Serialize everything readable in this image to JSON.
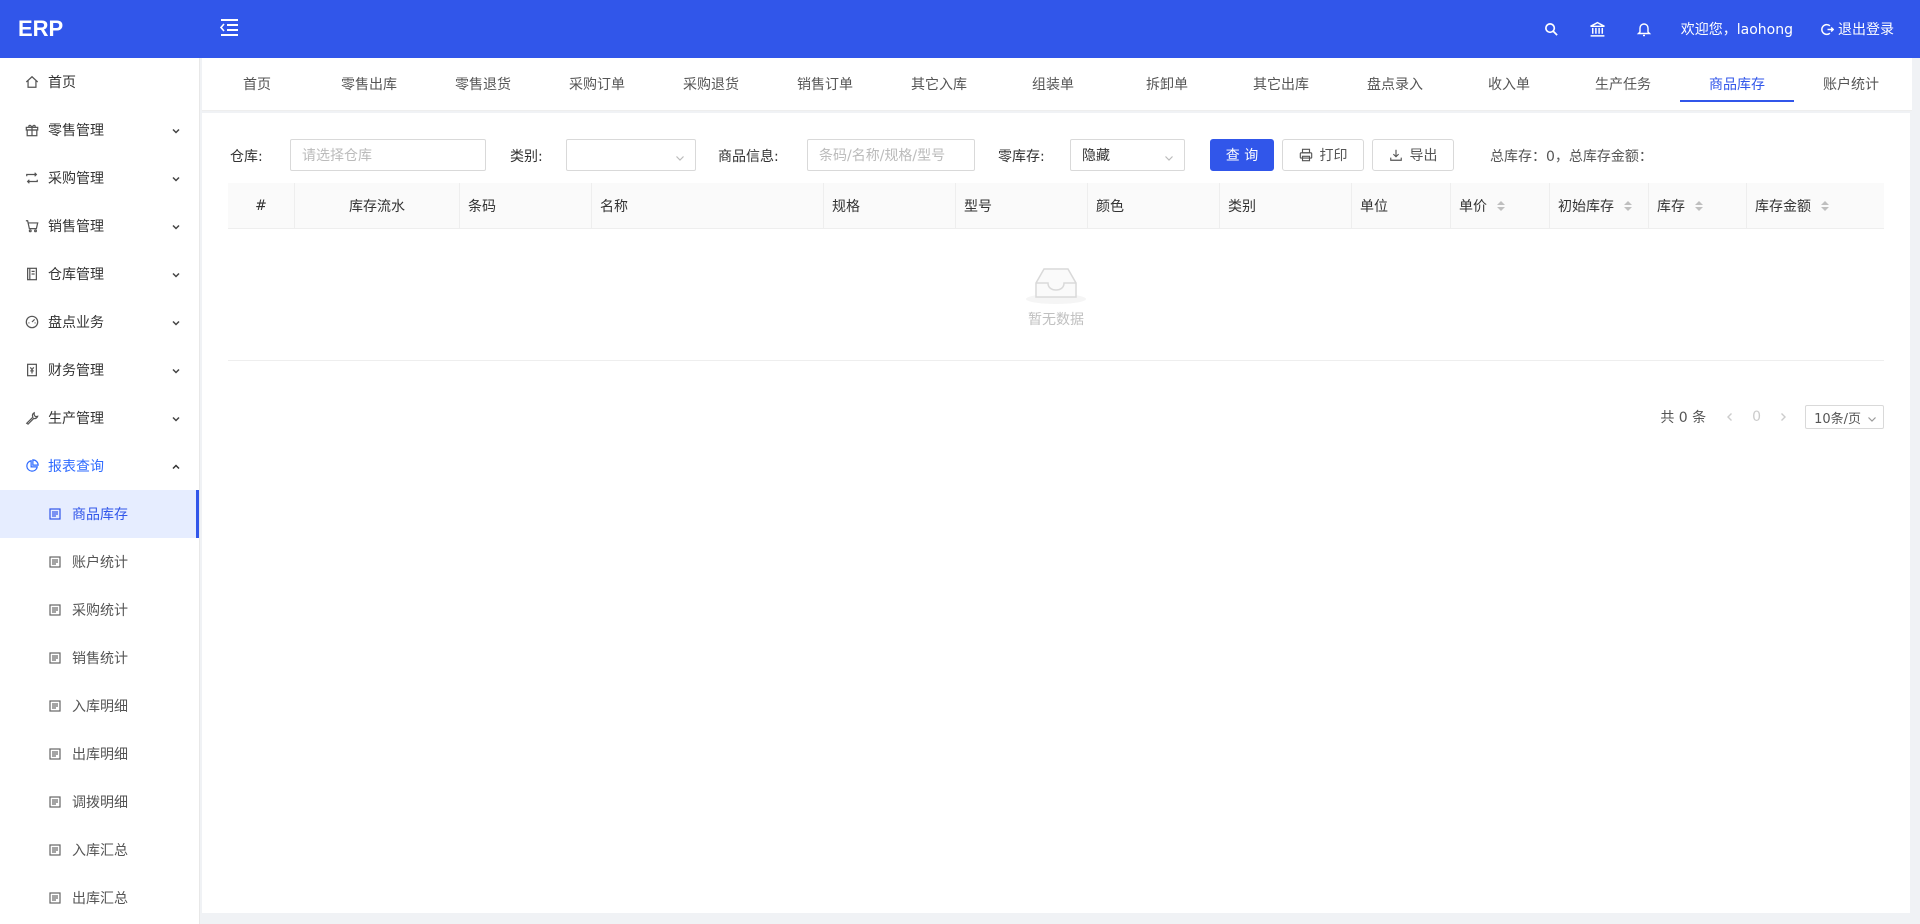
{
  "app": {
    "logo": "ERP"
  },
  "header": {
    "welcome": "欢迎您，laohong",
    "logout_label": "退出登录"
  },
  "sidebar": {
    "items": [
      {
        "label": "首页",
        "icon": "home-icon"
      },
      {
        "label": "零售管理",
        "icon": "gift-icon"
      },
      {
        "label": "采购管理",
        "icon": "swap-icon"
      },
      {
        "label": "销售管理",
        "icon": "cart-icon"
      },
      {
        "label": "仓库管理",
        "icon": "book-icon"
      },
      {
        "label": "盘点业务",
        "icon": "dashboard-icon"
      },
      {
        "label": "财务管理",
        "icon": "money-icon"
      },
      {
        "label": "生产管理",
        "icon": "tool-icon"
      },
      {
        "label": "报表查询",
        "icon": "pie-icon"
      }
    ],
    "sub_items": [
      {
        "label": "商品库存",
        "icon": "doc-icon"
      },
      {
        "label": "账户统计",
        "icon": "doc-icon"
      },
      {
        "label": "采购统计",
        "icon": "doc-icon"
      },
      {
        "label": "销售统计",
        "icon": "doc-icon"
      },
      {
        "label": "入库明细",
        "icon": "doc-icon"
      },
      {
        "label": "出库明细",
        "icon": "doc-icon"
      },
      {
        "label": "调拨明细",
        "icon": "doc-icon"
      },
      {
        "label": "入库汇总",
        "icon": "doc-icon"
      },
      {
        "label": "出库汇总",
        "icon": "doc-icon"
      }
    ]
  },
  "tabs": [
    "首页",
    "零售出库",
    "零售退货",
    "采购订单",
    "采购退货",
    "销售订单",
    "其它入库",
    "组装单",
    "拆卸单",
    "其它出库",
    "盘点录入",
    "收入单",
    "生产任务",
    "商品库存",
    "账户统计"
  ],
  "filters": {
    "warehouse_label": "仓库:",
    "warehouse_placeholder": "请选择仓库",
    "category_label": "类别:",
    "category_value": "",
    "product_label": "商品信息:",
    "product_placeholder": "条码/名称/规格/型号",
    "zero_stock_label": "零库存:",
    "zero_stock_value": "隐藏",
    "query_label": "查 询",
    "print_label": "打印",
    "export_label": "导出",
    "summary": "总库存：0，总库存金额："
  },
  "table": {
    "columns": [
      "#",
      "库存流水",
      "条码",
      "名称",
      "规格",
      "型号",
      "颜色",
      "类别",
      "单位",
      "单价",
      "初始库存",
      "库存",
      "库存金额"
    ],
    "empty_text": "暂无数据"
  },
  "pagination": {
    "total": "共 0 条",
    "current": "0",
    "page_size": "10条/页"
  },
  "colors": {
    "primary": "#3156ea",
    "active_bg": "#e6edff"
  }
}
